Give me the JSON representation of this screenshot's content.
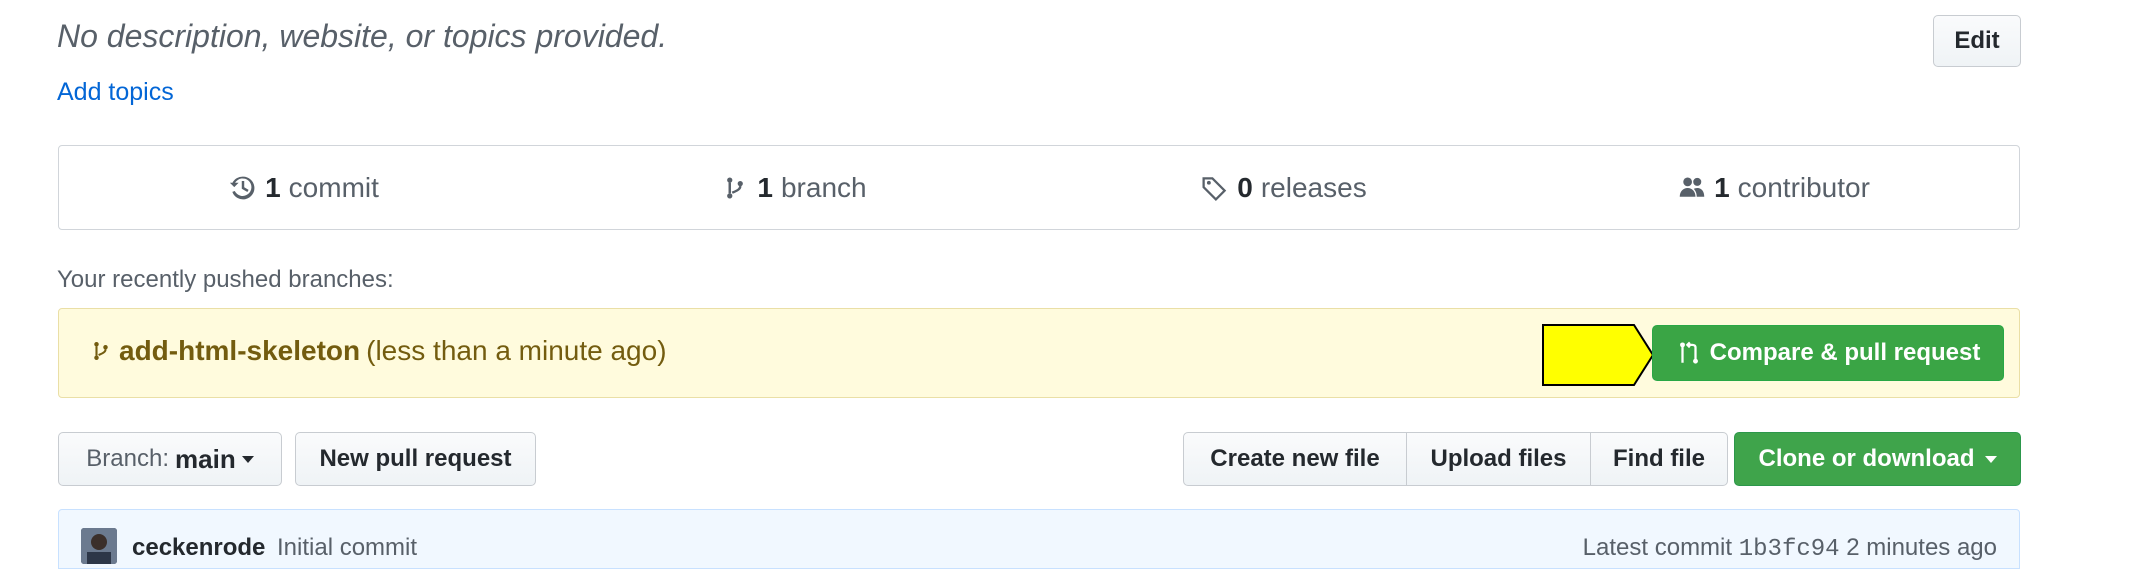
{
  "repo": {
    "description": "No description, website, or topics provided.",
    "add_topics": "Add topics",
    "edit_label": "Edit"
  },
  "summary": {
    "commits_count": "1",
    "commits_label": "commit",
    "branches_count": "1",
    "branches_label": "branch",
    "releases_count": "0",
    "releases_label": "releases",
    "contributors_count": "1",
    "contributors_label": "contributor"
  },
  "recent": {
    "label": "Your recently pushed branches:",
    "branch_name": "add-html-skeleton",
    "time": "(less than a minute ago)",
    "compare_label": "Compare & pull request"
  },
  "toolbar": {
    "branch_prefix": "Branch:",
    "branch_value": "main",
    "new_pr": "New pull request",
    "create_file": "Create new file",
    "upload_files": "Upload files",
    "find_file": "Find file",
    "clone": "Clone or download"
  },
  "commit": {
    "author": "ceckenrode",
    "message": "Initial commit",
    "latest_label": "Latest commit",
    "sha": "1b3fc94",
    "time": "2 minutes ago"
  },
  "colors": {
    "accent_green": "#3aa545",
    "link": "#0366d6",
    "highlight_arrow": "#ffff00"
  }
}
